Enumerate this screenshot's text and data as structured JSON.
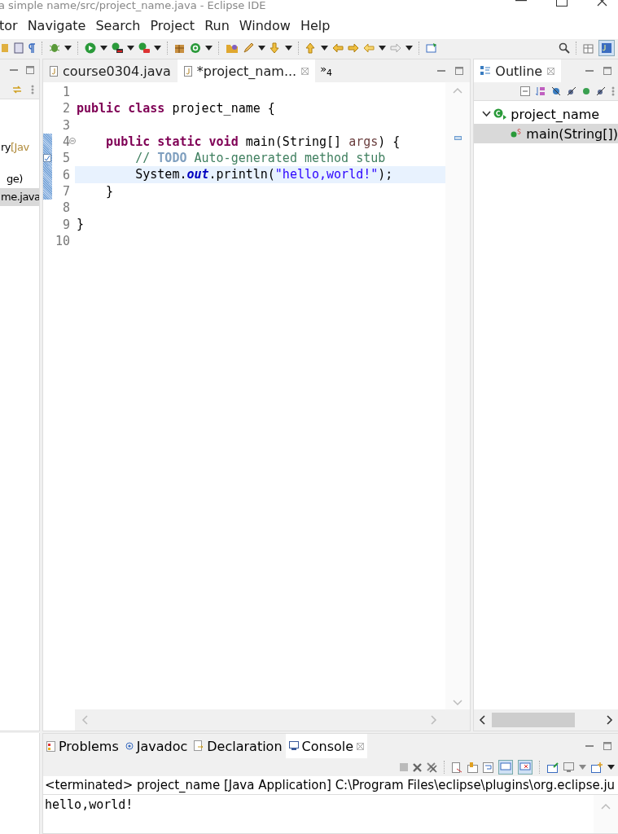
{
  "window": {
    "title": "a simple name/src/project_name.java - Eclipse IDE"
  },
  "menu": [
    "tor",
    "Navigate",
    "Search",
    "Project",
    "Run",
    "Window",
    "Help"
  ],
  "left_panel": {
    "items": [
      {
        "text": "ry",
        "suffix": "[Jav",
        "selected": false
      },
      {
        "text": "ge)",
        "selected": false
      },
      {
        "text": "me.java",
        "selected": true
      }
    ]
  },
  "editor": {
    "tabs": [
      {
        "label": "course0304.java",
        "selected": false
      },
      {
        "label": "*project_nam...",
        "selected": true
      }
    ],
    "overflow": "»$_{4}$",
    "lines": [
      {
        "number": "1",
        "current": false,
        "changed": false
      },
      {
        "number": "2",
        "tokens": [
          {
            "kind": "keyword",
            "text": "public class"
          },
          {
            "kind": "plain",
            "text": " project_name {"
          }
        ],
        "current": false,
        "changed": false
      },
      {
        "number": "3",
        "current": false,
        "changed": false
      },
      {
        "number": "4",
        "fold": true,
        "tokens": [
          {
            "kind": "keyword",
            "text": "    public static void"
          },
          {
            "kind": "plain",
            "text": " main(String[] "
          },
          {
            "kind": "param",
            "text": "args"
          },
          {
            "kind": "plain",
            "text": ") {"
          }
        ],
        "current": false,
        "changed": true
      },
      {
        "number": "5",
        "task": true,
        "tokens": [
          {
            "kind": "comment",
            "text": "        // "
          },
          {
            "kind": "todo",
            "text": "TODO"
          },
          {
            "kind": "comment",
            "text": " Auto-generated method stub"
          }
        ],
        "current": false,
        "changed": true
      },
      {
        "number": "6",
        "tokens": [
          {
            "kind": "plain",
            "text": "        System."
          },
          {
            "kind": "field",
            "text": "out"
          },
          {
            "kind": "plain",
            "text": ".println("
          },
          {
            "kind": "string",
            "text": "\"hello,world!\""
          },
          {
            "kind": "plain",
            "text": ");"
          }
        ],
        "current": true,
        "changed": true
      },
      {
        "number": "7",
        "tokens": [
          {
            "kind": "plain",
            "text": "    }"
          }
        ],
        "current": false,
        "changed": true
      },
      {
        "number": "8",
        "current": false,
        "changed": false
      },
      {
        "number": "9",
        "tokens": [
          {
            "kind": "plain",
            "text": "}"
          }
        ],
        "current": false,
        "changed": false
      },
      {
        "number": "10",
        "current": false,
        "changed": false
      }
    ]
  },
  "outline": {
    "title": "Outline",
    "tree": [
      {
        "label": "project_name",
        "expanded": true,
        "selected": false,
        "children": [
          {
            "label": "main(String[])",
            "selected": true
          }
        ]
      }
    ]
  },
  "bottom": {
    "tabs": [
      {
        "label": "Problems",
        "selected": false
      },
      {
        "label": "Javadoc",
        "selected": false
      },
      {
        "label": "Declaration",
        "selected": false
      },
      {
        "label": "Console",
        "selected": true
      }
    ],
    "console_header": "<terminated> project_name [Java Application] C:\\Program Files\\eclipse\\plugins\\org.eclipse.ju",
    "output": "hello,world!"
  }
}
